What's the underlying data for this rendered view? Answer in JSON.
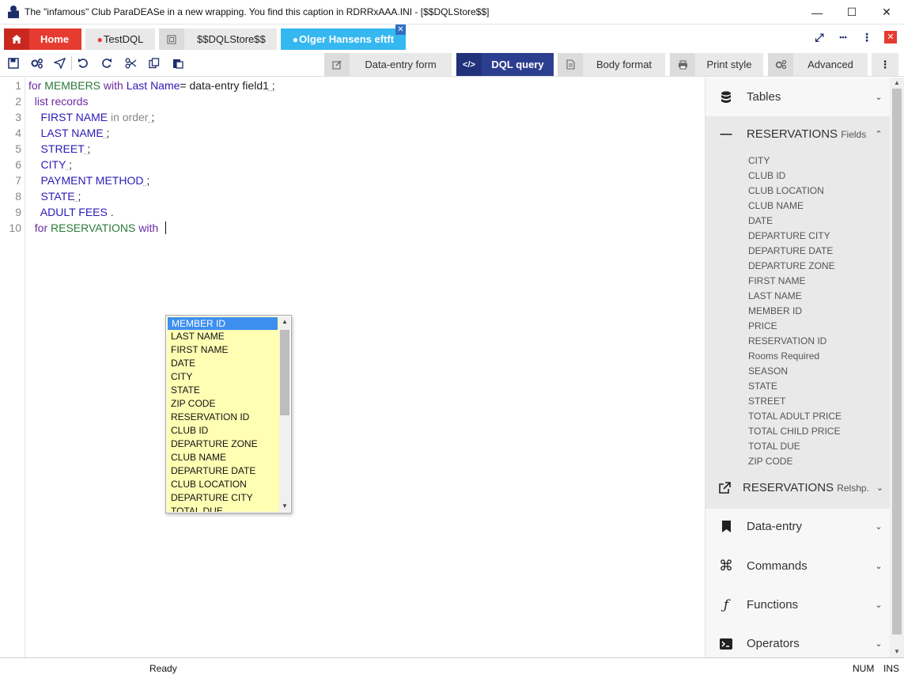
{
  "window": {
    "title": "The \"infamous\" Club ParaDEASe in a new wrapping. You find this caption in RDRRxAAA.INI - [$$DQLStore$$]",
    "minimize": "—",
    "maximize": "☐",
    "close": "✕"
  },
  "tabs": {
    "home": "Home",
    "testdql": "TestDQL",
    "store": "$$DQLStore$$",
    "olger": "Olger Hansens eftft",
    "close_glyph": "✕"
  },
  "right_controls": {
    "fullscreen": "⤢",
    "dots": "•••",
    "menu": "⋮",
    "close": "✕"
  },
  "view_tabs": [
    {
      "label": "Data-entry form"
    },
    {
      "label": "DQL query"
    },
    {
      "label": "Body format"
    },
    {
      "label": "Print style"
    },
    {
      "label": "Advanced"
    }
  ],
  "more_label": "⋮",
  "editor": {
    "line_numbers": [
      "1",
      "2",
      "3",
      "4",
      "5",
      "6",
      "7",
      "8",
      "9",
      "10"
    ],
    "lines": [
      [
        {
          "c": "kw",
          "t": "for "
        },
        {
          "c": "tb",
          "t": "MEMBERS"
        },
        {
          "c": "kw",
          "t": " with "
        },
        {
          "c": "fd",
          "t": "Last Name"
        },
        {
          "c": "pl",
          "t": "= data-entry "
        },
        {
          "c": "pl",
          "t": "field1"
        },
        {
          "c": "pu",
          "t": " ;"
        }
      ],
      [
        {
          "c": "kw",
          "t": "  list records"
        }
      ],
      [
        {
          "c": "fd",
          "t": "    FIRST NAME"
        },
        {
          "c": "mut",
          "t": " in order"
        },
        {
          "c": "pu",
          "t": " ;"
        }
      ],
      [
        {
          "c": "fd",
          "t": "    LAST NAME"
        },
        {
          "c": "pu",
          "t": " ;"
        }
      ],
      [
        {
          "c": "fd",
          "t": "    STREET"
        },
        {
          "c": "pu",
          "t": " ;"
        }
      ],
      [
        {
          "c": "fd",
          "t": "    CITY"
        },
        {
          "c": "pu",
          "t": " ;"
        }
      ],
      [
        {
          "c": "fd",
          "t": "    PAYMENT METHOD"
        },
        {
          "c": "pu",
          "t": " ;"
        }
      ],
      [
        {
          "c": "fd",
          "t": "    STATE"
        },
        {
          "c": "pu",
          "t": " ;"
        }
      ],
      [
        {
          "c": "fd",
          "t": "    ADULT FEES"
        },
        {
          "c": "pl",
          "t": " ."
        }
      ],
      [
        {
          "c": "kw",
          "t": "  for "
        },
        {
          "c": "tb",
          "t": "RESERVATIONS"
        },
        {
          "c": "kw",
          "t": " with  "
        }
      ]
    ]
  },
  "autocomplete": {
    "items": [
      "MEMBER ID",
      "LAST NAME",
      "FIRST NAME",
      "DATE",
      "CITY",
      "STATE",
      "ZIP CODE",
      "RESERVATION ID",
      "CLUB ID",
      "DEPARTURE ZONE",
      "CLUB NAME",
      "DEPARTURE DATE",
      "CLUB LOCATION",
      "DEPARTURE CITY",
      "TOTAL DUE"
    ],
    "selected_index": 0
  },
  "panel": {
    "tables": "Tables",
    "res_fields": "RESERVATIONS",
    "res_fields_suffix": "Fields",
    "fields": [
      "CITY",
      "CLUB ID",
      "CLUB LOCATION",
      "CLUB NAME",
      "DATE",
      "DEPARTURE CITY",
      "DEPARTURE DATE",
      "DEPARTURE ZONE",
      "FIRST NAME",
      "LAST NAME",
      "MEMBER ID",
      "PRICE",
      "RESERVATION ID",
      "Rooms Required",
      "SEASON",
      "STATE",
      "STREET",
      "TOTAL ADULT PRICE",
      "TOTAL CHILD PRICE",
      "TOTAL DUE",
      "ZIP CODE"
    ],
    "res_relshp": "RESERVATIONS",
    "res_relshp_suffix": "Relshp.",
    "data_entry": "Data-entry",
    "commands": "Commands",
    "functions": "Functions",
    "operators": "Operators"
  },
  "status": {
    "ready": "Ready",
    "num": "NUM",
    "ins": "INS"
  }
}
